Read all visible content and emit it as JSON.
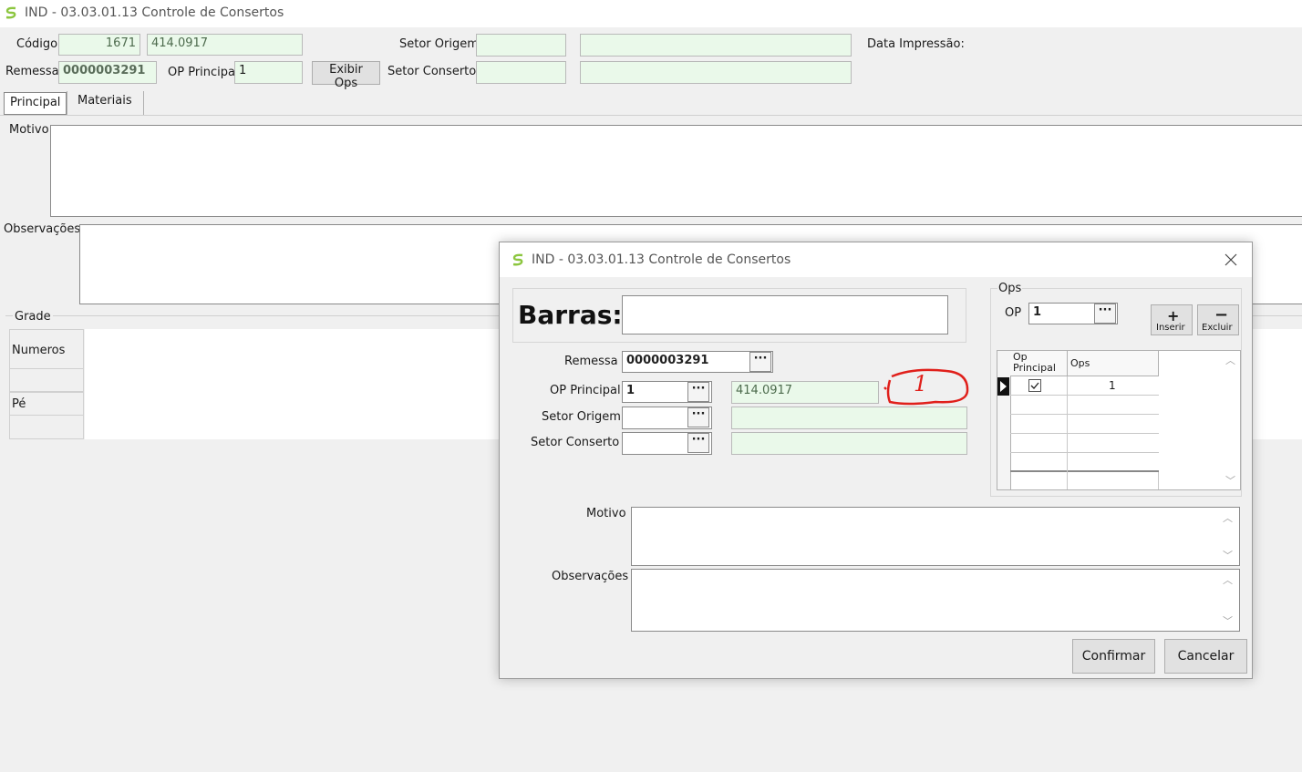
{
  "window": {
    "title": "IND - 03.03.01.13 Controle de Consertos"
  },
  "main": {
    "codigo_label": "Código",
    "codigo_value": "1671",
    "codigo_desc": "414.0917",
    "remessa_label": "Remessa",
    "remessa_value": "0000003291",
    "op_principal_label": "OP Principal",
    "op_principal_value": "1",
    "exibir_ops_label": "Exibir Ops",
    "setor_origem_label": "Setor Origem",
    "setor_conserto_label": "Setor Conserto",
    "data_impressao_label": "Data Impressão:",
    "tabs": [
      {
        "label": "Principal"
      },
      {
        "label": "Materiais"
      }
    ],
    "motivo_label": "Motivo",
    "observacoes_label": "Observações",
    "grade_label": "Grade",
    "grade_rows": [
      {
        "label": "Numeros"
      },
      {
        "label": "Pé"
      }
    ]
  },
  "dialog": {
    "title": "IND - 03.03.01.13 Controle de Consertos",
    "barras_label": "Barras:",
    "remessa_label": "Remessa",
    "remessa_value": "0000003291",
    "op_principal_label": "OP Principal",
    "op_principal_value": "1",
    "op_principal_desc": "414.0917",
    "setor_origem_label": "Setor Origem",
    "setor_conserto_label": "Setor Conserto",
    "motivo_label": "Motivo",
    "observacoes_label": "Observações",
    "annotation_text": "1",
    "ops": {
      "group_label": "Ops",
      "op_label": "OP",
      "op_value": "1",
      "inserir_label": "Inserir",
      "excluir_label": "Excluir",
      "columns": {
        "op_principal_line1": "Op",
        "op_principal_line2": "Principal",
        "ops": "Ops"
      },
      "rows": [
        {
          "op_principal": true,
          "ops": "1"
        }
      ]
    },
    "confirmar_label": "Confirmar",
    "cancelar_label": "Cancelar"
  }
}
